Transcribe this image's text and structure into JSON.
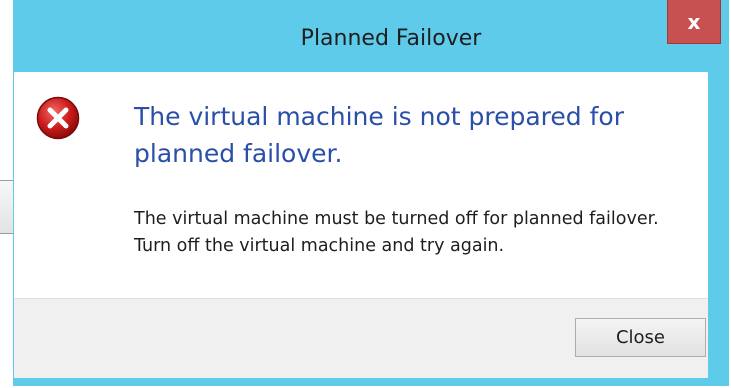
{
  "dialog": {
    "title": "Planned Failover",
    "close_glyph": "x",
    "icon": "error-icon",
    "main_instruction": "The virtual machine is not prepared for planned failover.",
    "content": "The virtual machine must be turned off for planned failover. Turn off the virtual machine and try again.",
    "close_button_label": "Close"
  },
  "colors": {
    "titlebar": "#5ecbeb",
    "close_x_bg": "#c75050",
    "instruction_text": "#2a4fa8",
    "footer_bg": "#f0f0f0",
    "error_red": "#c01818"
  }
}
